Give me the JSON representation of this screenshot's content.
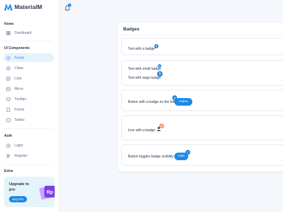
{
  "brand": {
    "name": "MaterialM"
  },
  "sidebar": {
    "sections": [
      {
        "title": "Home"
      },
      {
        "title": "UI Components"
      },
      {
        "title": "Auth"
      },
      {
        "title": "Extra"
      }
    ],
    "items": [
      {
        "label": "Dashboard",
        "icon": "layout-icon"
      },
      {
        "label": "Badge",
        "icon": "badge-icon",
        "active": true
      },
      {
        "label": "Chips",
        "icon": "chip-icon"
      },
      {
        "label": "Lists",
        "icon": "list-icon"
      },
      {
        "label": "Menu",
        "icon": "menu-icon"
      },
      {
        "label": "Tooltips",
        "icon": "tooltip-icon"
      },
      {
        "label": "Forms",
        "icon": "form-icon"
      },
      {
        "label": "Tables",
        "icon": "table-icon"
      },
      {
        "label": "Login",
        "icon": "login-icon"
      },
      {
        "label": "Register",
        "icon": "user-plus-icon"
      }
    ],
    "upgrade": {
      "title": "Upgrade to pro",
      "button": "Buy Pro",
      "art_label": "Rp"
    }
  },
  "topbar": {
    "notification_count": "1"
  },
  "card": {
    "title": "Badges",
    "rows": [
      {
        "text": "Text with a badge",
        "badge": "4"
      },
      {
        "text_small": "Text with small badge",
        "badge_small": "1",
        "text_large": "Text with large badge",
        "badge_large": "1"
      },
      {
        "text": "Button with a badge on the left",
        "badge": "4",
        "button": "Action"
      },
      {
        "text": "Icon with a badge",
        "badge": "99"
      },
      {
        "text": "Button toggles badge visibility",
        "badge": "7",
        "button": "Hide"
      }
    ]
  },
  "colors": {
    "primary": "#1e88e5",
    "active_bg": "#e5f3fb",
    "badge_error": "#fa896b",
    "text": "#2a3547"
  }
}
